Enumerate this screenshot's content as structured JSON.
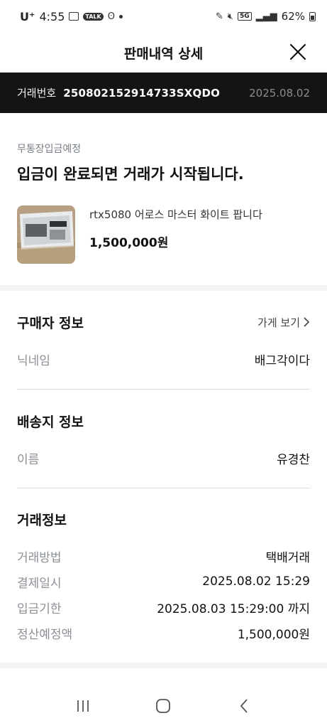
{
  "status_bar": {
    "carrier": "U⁺",
    "time": "4:55",
    "chat_badge": "TALK",
    "network": "5G",
    "battery": "62%"
  },
  "header": {
    "title": "판매내역 상세"
  },
  "order": {
    "label": "거래번호",
    "number": "250802152914733SXQDO",
    "date": "2025.08.02"
  },
  "status": {
    "subtitle": "무통장입금예정",
    "title": "입금이 완료되면 거래가 시작됩니다."
  },
  "product": {
    "name": "rtx5080 어로스 마스터 화이트 팝니다",
    "price": "1,500,000원"
  },
  "buyer": {
    "title": "구매자 정보",
    "link": "가게 보기",
    "rows": [
      {
        "label": "닉네임",
        "value": "배그각이다"
      }
    ]
  },
  "shipping": {
    "title": "배송지 정보",
    "rows": [
      {
        "label": "이름",
        "value": "유경찬"
      }
    ]
  },
  "transaction": {
    "title": "거래정보",
    "rows": [
      {
        "label": "거래방법",
        "value": "택배거래"
      },
      {
        "label": "결제일시",
        "value": "2025.08.02 15:29"
      },
      {
        "label": "입금기한",
        "value": "2025.08.03 15:29:00 까지"
      },
      {
        "label": "정산예정액",
        "value": "1,500,000원"
      }
    ]
  },
  "colors": {
    "order_bar_bg": "#141414",
    "label_gray": "#8b9096",
    "section_gap": "#f4f4f4"
  }
}
